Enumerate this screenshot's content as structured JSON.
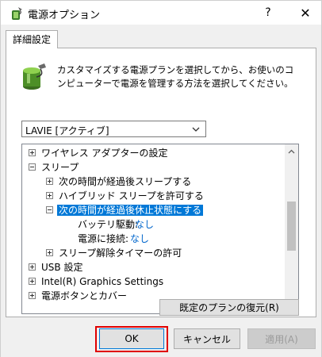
{
  "window": {
    "title": "電源オプション",
    "help_label": "?",
    "close_label": "✕"
  },
  "tab": {
    "label": "詳細設定"
  },
  "description": "カスタマイズする電源プランを選択してから、お使いのコンピューターで電源を管理する方法を選択してください。",
  "plan_select": {
    "selected": "LAVIE [アクティブ]"
  },
  "tree": {
    "items": [
      {
        "label": "ワイヤレス アダプターの設定"
      },
      {
        "label": "スリープ"
      },
      {
        "label": "次の時間が経過後スリープする"
      },
      {
        "label": "ハイブリッド スリープを許可する"
      },
      {
        "label": "次の時間が経過後休止状態にする"
      },
      {
        "label": "バッテリ駆動:",
        "value": "なし"
      },
      {
        "label": "電源に接続:",
        "value": "なし"
      },
      {
        "label": "スリープ解除タイマーの許可"
      },
      {
        "label": "USB 設定"
      },
      {
        "label": "Intel(R) Graphics Settings"
      },
      {
        "label": "電源ボタンとカバー"
      }
    ]
  },
  "buttons": {
    "restore": "既定のプランの復元(R)",
    "ok": "OK",
    "cancel": "キャンセル",
    "apply": "適用(A)"
  },
  "colors": {
    "selection": "#0078d7",
    "link": "#0066cc",
    "highlight": "#e00000"
  }
}
